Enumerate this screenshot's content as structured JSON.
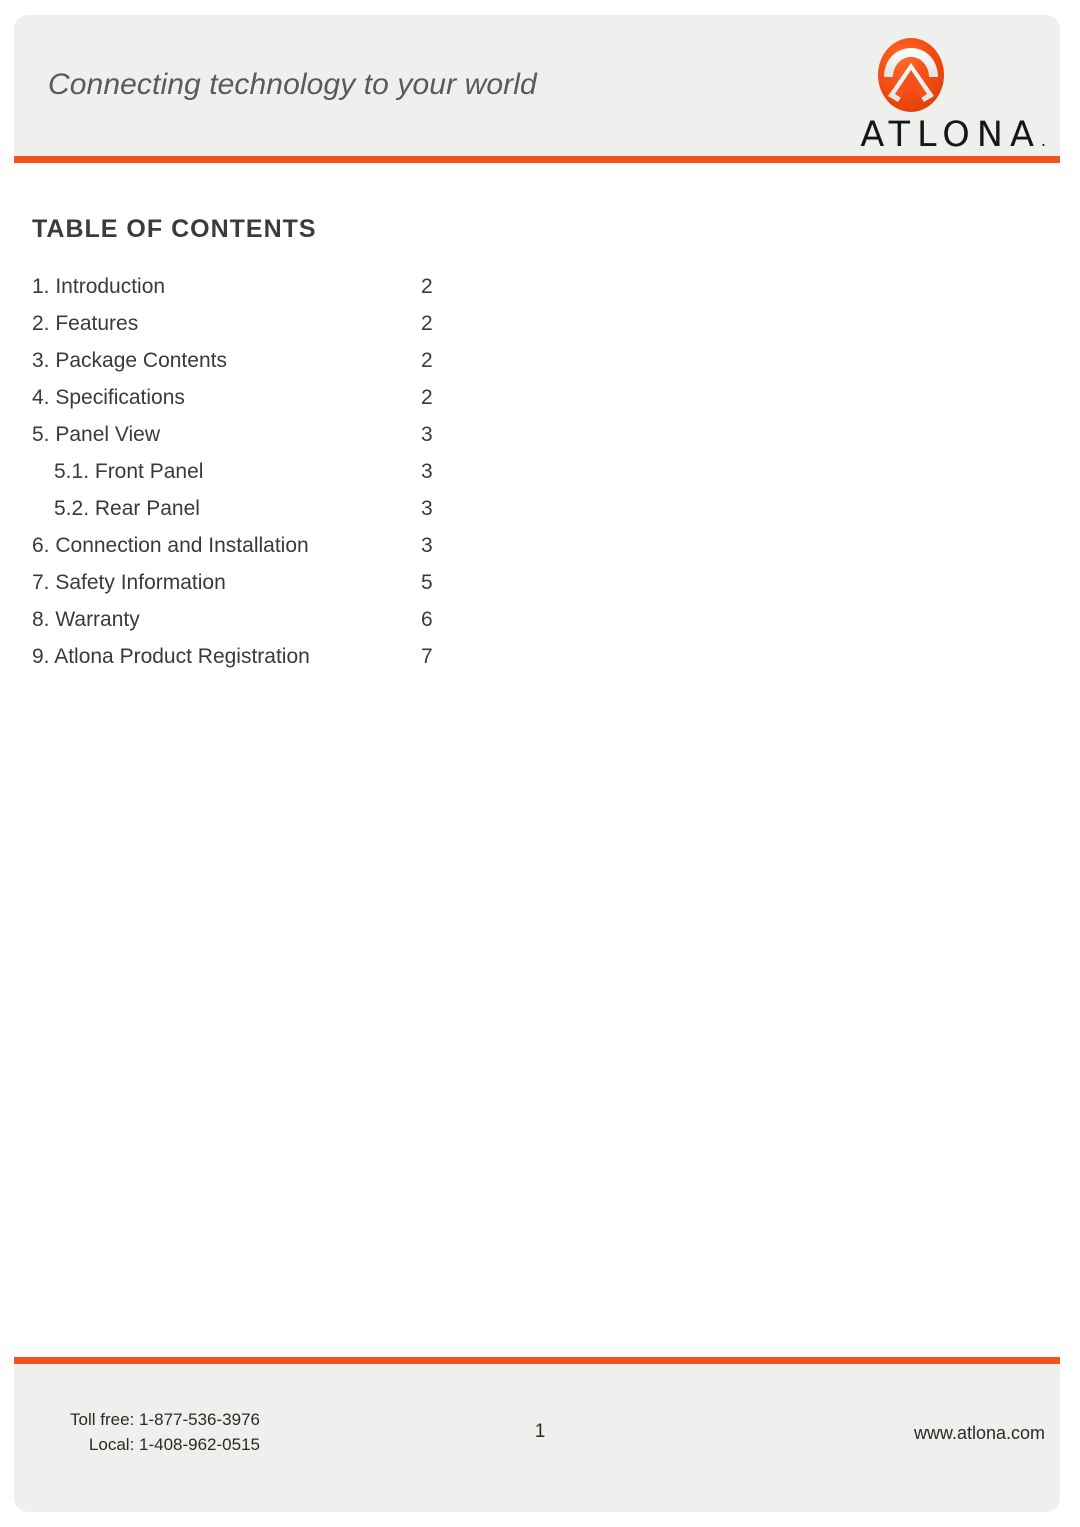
{
  "header": {
    "tagline": "Connecting technology to your world",
    "logo": {
      "mark_name": "atlona-circle-chevron-logo",
      "wordmark": "ATLONA",
      "registered_mark": ".",
      "brand_orange": "#F4511E"
    }
  },
  "main": {
    "toc_title": "TABLE OF CONTENTS",
    "entries": [
      {
        "label": "1. Introduction",
        "page": "2",
        "level": 1
      },
      {
        "label": "2. Features",
        "page": "2",
        "level": 1
      },
      {
        "label": "3. Package Contents",
        "page": "2",
        "level": 1
      },
      {
        "label": "4. Specifications",
        "page": "2",
        "level": 1
      },
      {
        "label": "5. Panel View",
        "page": "3",
        "level": 1
      },
      {
        "label": "5.1. Front Panel",
        "page": "3",
        "level": 2
      },
      {
        "label": "5.2. Rear Panel",
        "page": "3",
        "level": 2
      },
      {
        "label": "6. Connection and Installation",
        "page": "3",
        "level": 1
      },
      {
        "label": "7. Safety Information",
        "page": "5",
        "level": 1
      },
      {
        "label": "8. Warranty",
        "page": "6",
        "level": 1
      },
      {
        "label": "9. Atlona Product Registration",
        "page": "7",
        "level": 1
      }
    ]
  },
  "footer": {
    "toll_free": "Toll free: 1-877-536-3976",
    "local": "Local: 1-408-962-0515",
    "page_number": "1",
    "website": "www.atlona.com"
  }
}
